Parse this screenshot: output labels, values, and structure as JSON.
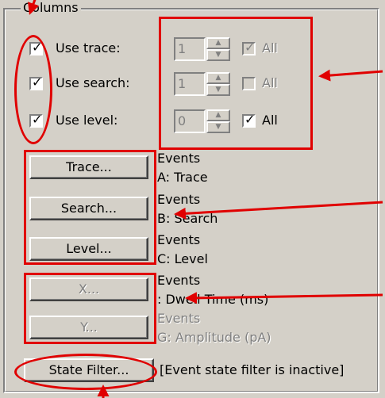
{
  "group": {
    "title": "Columns"
  },
  "rows": [
    {
      "label": "Use trace:",
      "value": "1",
      "all_label": "All"
    },
    {
      "label": "Use search:",
      "value": "1",
      "all_label": "All"
    },
    {
      "label": "Use level:",
      "value": "0",
      "all_label": "All"
    }
  ],
  "buttons": [
    {
      "label": "Trace...",
      "line1": "Events",
      "line2": "A: Trace"
    },
    {
      "label": "Search...",
      "line1": "Events",
      "line2": "B: Search"
    },
    {
      "label": "Level...",
      "line1": "Events",
      "line2": "C: Level"
    },
    {
      "label": "X...",
      "line1": "Events",
      "line2": ": Dwell Time (ms)"
    },
    {
      "label": "Y...",
      "line1": "Events",
      "line2": "G: Amplitude (pA)"
    }
  ],
  "state_filter": {
    "label": "State Filter...",
    "status": "[Event state filter is inactive]"
  },
  "colors": {
    "annotation": "#e00000",
    "face": "#d4d0c8"
  }
}
